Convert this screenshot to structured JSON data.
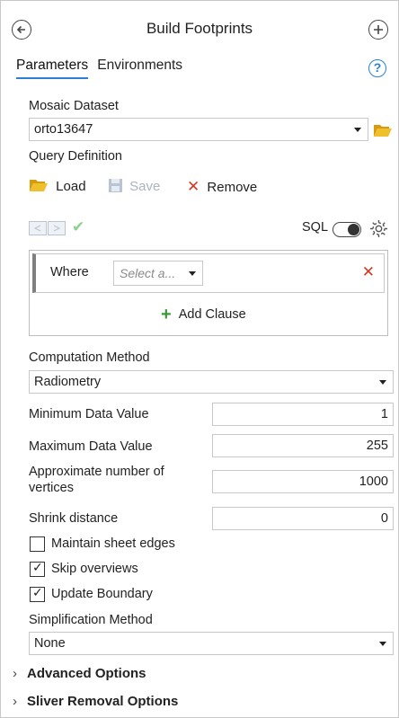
{
  "header": {
    "title": "Build Footprints"
  },
  "tabs": [
    {
      "label": "Parameters",
      "active": true
    },
    {
      "label": "Environments",
      "active": false
    }
  ],
  "help_glyph": "?",
  "mosaic": {
    "label": "Mosaic Dataset",
    "value": "orto13647"
  },
  "query": {
    "label": "Query Definition",
    "load_label": "Load",
    "save_label": "Save",
    "remove_label": "Remove",
    "sql_label": "SQL",
    "where_label": "Where",
    "select_placeholder": "Select a...",
    "add_clause_label": "Add Clause"
  },
  "computation": {
    "label": "Computation Method",
    "value": "Radiometry"
  },
  "min_data": {
    "label": "Minimum Data Value",
    "value": "1"
  },
  "max_data": {
    "label": "Maximum Data Value",
    "value": "255"
  },
  "approx_vertices": {
    "label_line1": "Approximate number of",
    "label_line2": "vertices",
    "value": "1000"
  },
  "shrink": {
    "label": "Shrink distance",
    "value": "0"
  },
  "checkboxes": [
    {
      "label": "Maintain sheet edges",
      "checked": false
    },
    {
      "label": "Skip overviews",
      "checked": true
    },
    {
      "label": "Update Boundary",
      "checked": true
    }
  ],
  "simplification": {
    "label": "Simplification Method",
    "value": "None"
  },
  "expanders": [
    {
      "label": "Advanced Options"
    },
    {
      "label": "Sliver Removal Options"
    }
  ],
  "colors": {
    "accent": "#2a7fd4",
    "remove_red": "#d13a24",
    "add_green": "#3a9a3a",
    "folder_yellow": "#e8b020"
  }
}
